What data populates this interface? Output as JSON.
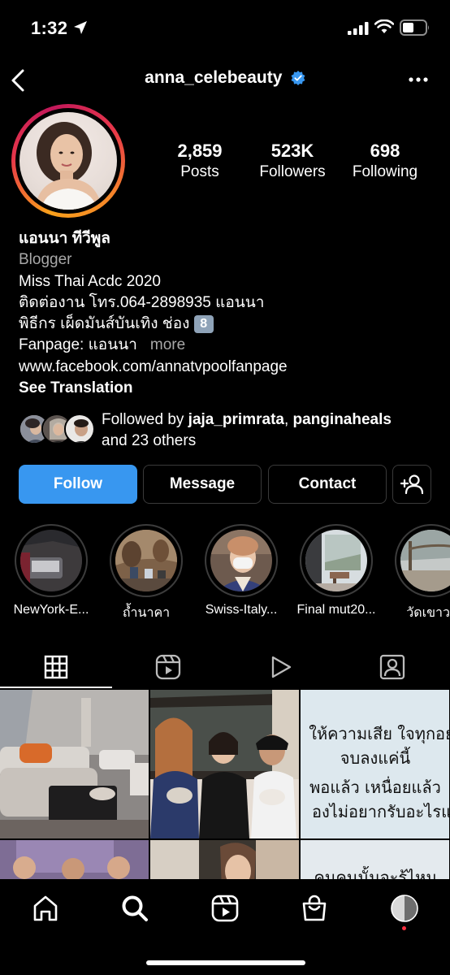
{
  "status_bar": {
    "time": "1:32"
  },
  "header": {
    "username": "anna_celebeauty"
  },
  "stats": [
    {
      "value": "2,859",
      "label": "Posts"
    },
    {
      "value": "523K",
      "label": "Followers"
    },
    {
      "value": "698",
      "label": "Following"
    }
  ],
  "bio": {
    "name": "แอนนา ทีวีพูล",
    "category": "Blogger",
    "line1": "Miss Thai Acdc 2020",
    "line2": "ติดต่องาน โทร.064-2898935 แอนนา",
    "line3": "พิธีกร เผ็ดมันส์บันเทิง ช่อง",
    "line3_badge": "8",
    "line4": "Fanpage: แอนนา",
    "more": "more",
    "link": "www.facebook.com/annatvpoolfanpage",
    "see_translation": "See Translation"
  },
  "followed_by": {
    "prefix": "Followed by",
    "user1": "jaja_primrata",
    "separator": ",",
    "user2": "panginaheals",
    "and_text": "and 23 others"
  },
  "buttons": {
    "follow": "Follow",
    "message": "Message",
    "contact": "Contact"
  },
  "highlights": [
    {
      "label": "NewYork-E..."
    },
    {
      "label": "ถ้ำนาคา"
    },
    {
      "label": "Swiss-Italy..."
    },
    {
      "label": "Final mut20..."
    },
    {
      "label": "วัดเขาวง"
    }
  ],
  "posts": {
    "thai_text_post": [
      "ให้ความเสีย ใจทุกอย่",
      "จบลงแค่นี้",
      "พอแล้ว เหนื่อยแล้ว",
      "องไม่อยากรับอะไรแ"
    ],
    "thai_text_post2": "คนคนนั้นจะรู้ไหม"
  },
  "colors": {
    "follow_button": "#3897f0",
    "verified": "#3897f0",
    "background": "#000000"
  }
}
